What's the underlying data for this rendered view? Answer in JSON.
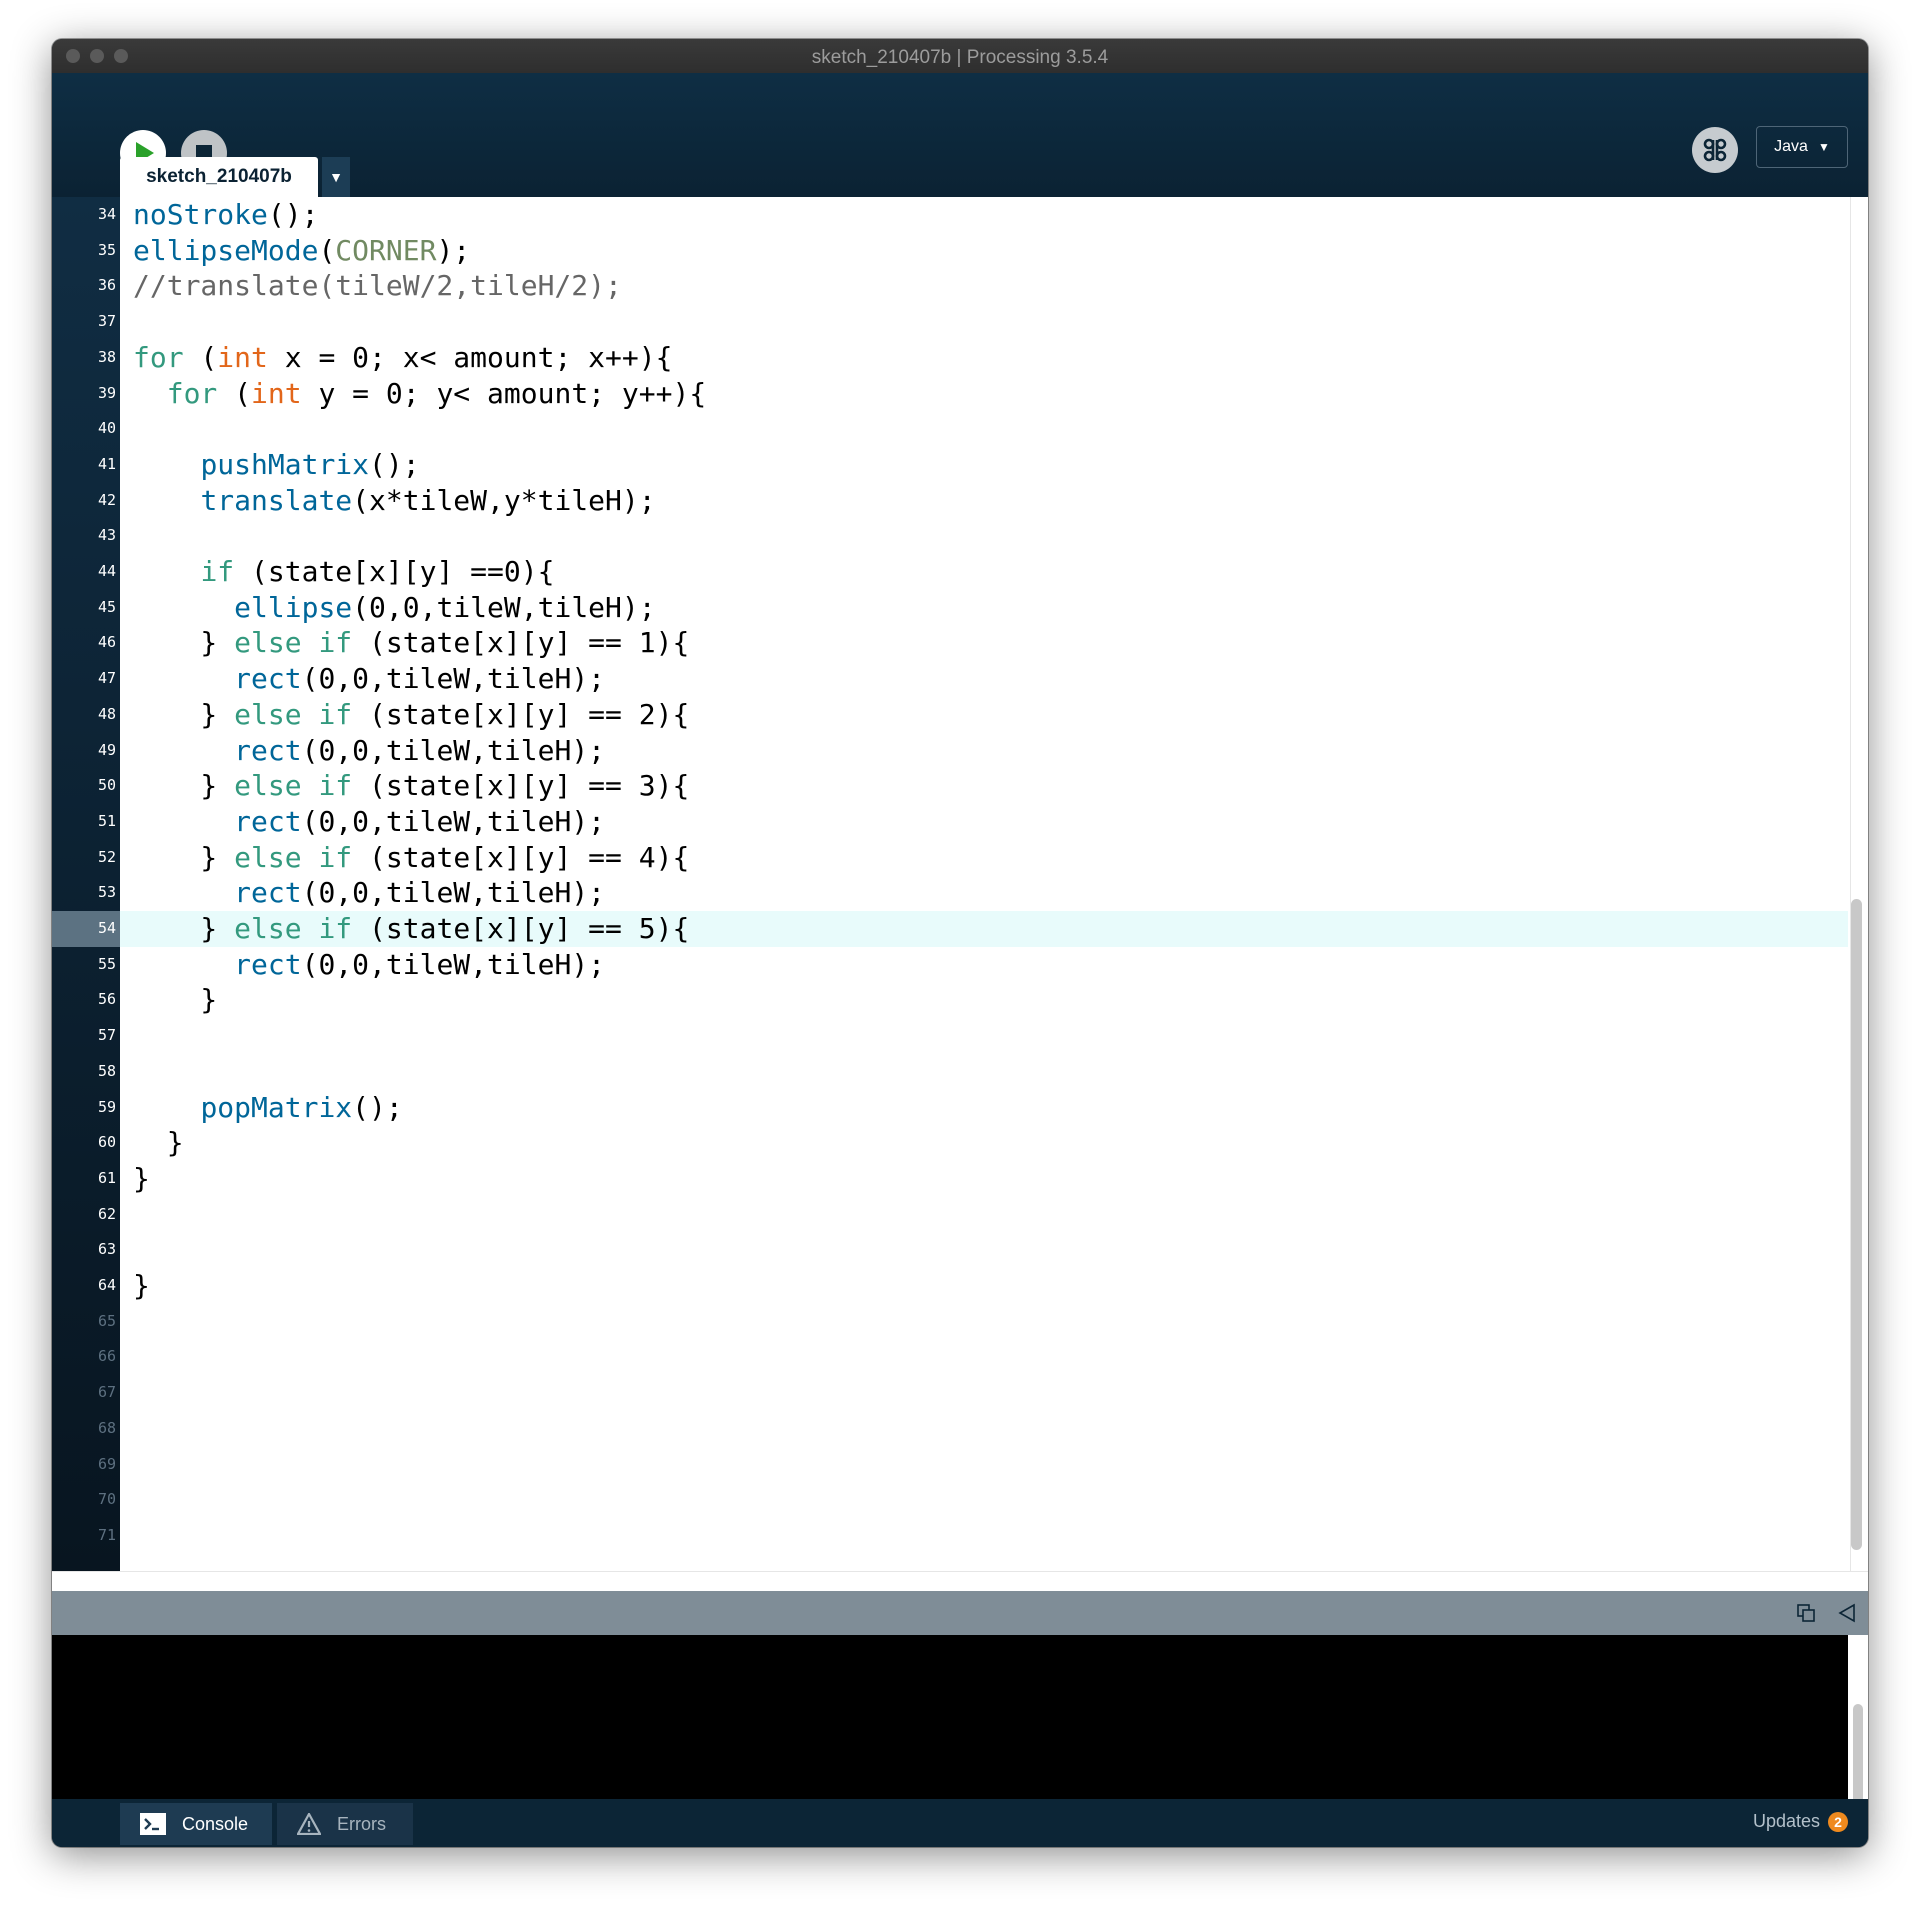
{
  "window": {
    "title": "sketch_210407b | Processing 3.5.4"
  },
  "toolbar": {
    "mode": "Java",
    "colors": {
      "run_icon": "#2aa12a",
      "toolbar_bg": "#0c2536"
    }
  },
  "tabs": [
    {
      "label": "sketch_210407b"
    }
  ],
  "editor": {
    "current_line": "54",
    "lines": [
      {
        "num": "34",
        "code": "noStroke();"
      },
      {
        "num": "35",
        "code": "ellipseMode(CORNER);"
      },
      {
        "num": "36",
        "code": "//translate(tileW/2,tileH/2);"
      },
      {
        "num": "37",
        "code": ""
      },
      {
        "num": "38",
        "code": "for (int x = 0; x< amount; x++){"
      },
      {
        "num": "39",
        "code": "  for (int y = 0; y< amount; y++){"
      },
      {
        "num": "40",
        "code": ""
      },
      {
        "num": "41",
        "code": "    pushMatrix();"
      },
      {
        "num": "42",
        "code": "    translate(x*tileW,y*tileH);"
      },
      {
        "num": "43",
        "code": ""
      },
      {
        "num": "44",
        "code": "    if (state[x][y] ==0){"
      },
      {
        "num": "45",
        "code": "      ellipse(0,0,tileW,tileH);"
      },
      {
        "num": "46",
        "code": "    } else if (state[x][y] == 1){"
      },
      {
        "num": "47",
        "code": "      rect(0,0,tileW,tileH);"
      },
      {
        "num": "48",
        "code": "    } else if (state[x][y] == 2){"
      },
      {
        "num": "49",
        "code": "      rect(0,0,tileW,tileH);"
      },
      {
        "num": "50",
        "code": "    } else if (state[x][y] == 3){"
      },
      {
        "num": "51",
        "code": "      rect(0,0,tileW,tileH);"
      },
      {
        "num": "52",
        "code": "    } else if (state[x][y] == 4){"
      },
      {
        "num": "53",
        "code": "      rect(0,0,tileW,tileH);"
      },
      {
        "num": "54",
        "code": "    } else if (state[x][y] == 5){"
      },
      {
        "num": "55",
        "code": "      rect(0,0,tileW,tileH);"
      },
      {
        "num": "56",
        "code": "    }"
      },
      {
        "num": "57",
        "code": ""
      },
      {
        "num": "58",
        "code": ""
      },
      {
        "num": "59",
        "code": "    popMatrix();"
      },
      {
        "num": "60",
        "code": "  }"
      },
      {
        "num": "61",
        "code": "}"
      },
      {
        "num": "62",
        "code": ""
      },
      {
        "num": "63",
        "code": ""
      },
      {
        "num": "64",
        "code": "}"
      },
      {
        "num": "65",
        "code": ""
      },
      {
        "num": "66",
        "code": ""
      },
      {
        "num": "67",
        "code": ""
      },
      {
        "num": "68",
        "code": ""
      },
      {
        "num": "69",
        "code": ""
      },
      {
        "num": "70",
        "code": ""
      },
      {
        "num": "71",
        "code": ""
      }
    ]
  },
  "bottom_tabs": {
    "console": "Console",
    "errors": "Errors"
  },
  "updates": {
    "label": "Updates",
    "count": "2"
  }
}
